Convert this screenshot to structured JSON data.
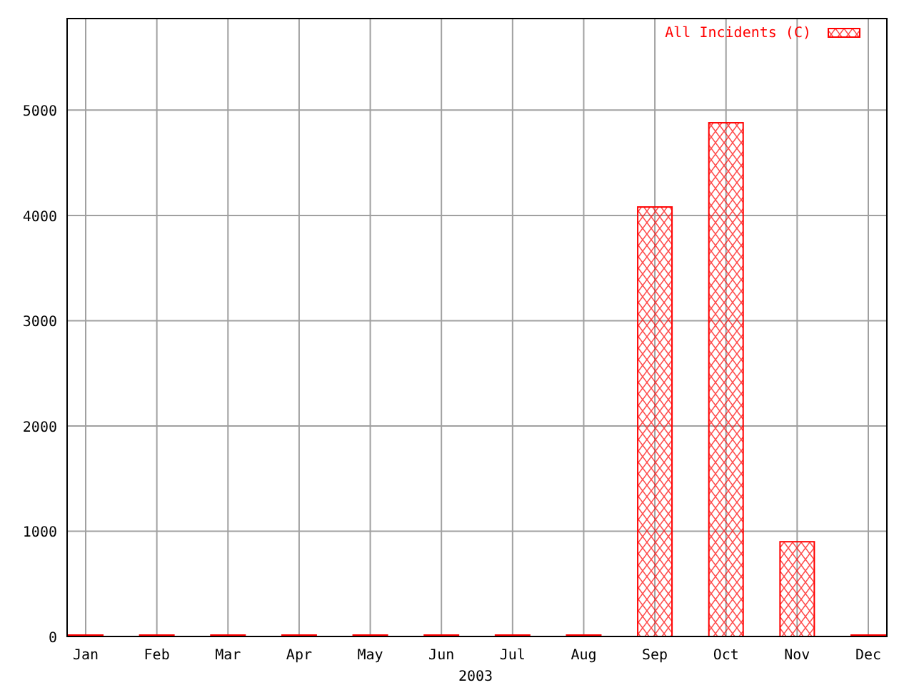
{
  "chart": {
    "chart_data": {
      "type": "bar",
      "xlabel": "2003",
      "categories": [
        "Jan",
        "Feb",
        "Mar",
        "Apr",
        "May",
        "Jun",
        "Jul",
        "Aug",
        "Sep",
        "Oct",
        "Nov",
        "Dec"
      ],
      "series": [
        {
          "name": "All Incidents (C)",
          "color": "#ff0000",
          "values": [
            0,
            0,
            0,
            0,
            0,
            0,
            0,
            0,
            4080,
            4880,
            900,
            0
          ]
        }
      ],
      "ylim": [
        0,
        5870
      ],
      "grid": true,
      "yticks": [
        0,
        1000,
        2000,
        3000,
        4000,
        5000
      ]
    }
  }
}
